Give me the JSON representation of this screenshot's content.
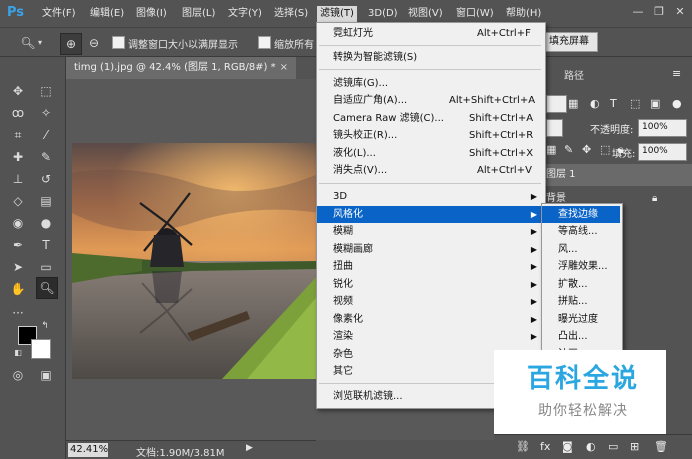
{
  "app": {
    "logo": "Ps"
  },
  "menubar": {
    "items": [
      "文件(F)",
      "编辑(E)",
      "图像(I)",
      "图层(L)",
      "文字(Y)",
      "选择(S)",
      "滤镜(T)",
      "3D(D)",
      "视图(V)",
      "窗口(W)",
      "帮助(H)"
    ]
  },
  "options": {
    "resize_windows_label": "调整窗口大小以满屏显示",
    "zoom_all_label": "缩放所有",
    "fill_screen_label": "填充屏幕"
  },
  "document": {
    "tab_title": "timg (1).jpg @ 42.4% (图层 1, RGB/8#) *",
    "zoom": "42.41%",
    "doc_size": "文档:1.90M/3.81M"
  },
  "panels": {
    "tab_paths": "路径",
    "opacity_label": "不透明度:",
    "opacity_value": "100%",
    "fill_label": "填充:",
    "fill_value": "100%",
    "layers": [
      "图层 1",
      "背景"
    ]
  },
  "filter_menu": {
    "items": [
      {
        "label": "霓虹灯光",
        "shortcut": "Alt+Ctrl+F"
      },
      {
        "label": "转换为智能滤镜(S)",
        "shortcut": ""
      },
      {
        "label": "滤镜库(G)...",
        "shortcut": ""
      },
      {
        "label": "自适应广角(A)...",
        "shortcut": "Alt+Shift+Ctrl+A"
      },
      {
        "label": "Camera Raw 滤镜(C)...",
        "shortcut": "Shift+Ctrl+A"
      },
      {
        "label": "镜头校正(R)...",
        "shortcut": "Shift+Ctrl+R"
      },
      {
        "label": "液化(L)...",
        "shortcut": "Shift+Ctrl+X"
      },
      {
        "label": "消失点(V)...",
        "shortcut": "Alt+Ctrl+V"
      },
      {
        "label": "3D",
        "shortcut": ""
      },
      {
        "label": "风格化",
        "shortcut": ""
      },
      {
        "label": "模糊",
        "shortcut": ""
      },
      {
        "label": "模糊画廊",
        "shortcut": ""
      },
      {
        "label": "扭曲",
        "shortcut": ""
      },
      {
        "label": "锐化",
        "shortcut": ""
      },
      {
        "label": "视频",
        "shortcut": ""
      },
      {
        "label": "像素化",
        "shortcut": ""
      },
      {
        "label": "渲染",
        "shortcut": ""
      },
      {
        "label": "杂色",
        "shortcut": ""
      },
      {
        "label": "其它",
        "shortcut": ""
      },
      {
        "label": "浏览联机滤镜...",
        "shortcut": ""
      }
    ]
  },
  "stylize_submenu": {
    "items": [
      "查找边缘",
      "等高线...",
      "风...",
      "浮雕效果...",
      "扩散...",
      "拼贴...",
      "曝光过度",
      "凸出...",
      "油画..."
    ]
  },
  "watermark": {
    "main": "百科全说",
    "sub": "助你轻松解决"
  },
  "colors": {
    "highlight": "#0a64c8",
    "watermark_blue": "#2aa6e0"
  }
}
